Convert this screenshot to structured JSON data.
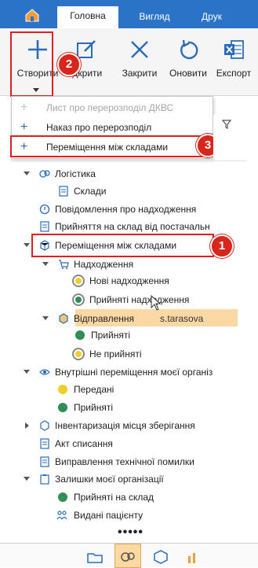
{
  "ribbon": {
    "tabs": [
      {
        "label": "Головна"
      },
      {
        "label": "Вигляд"
      },
      {
        "label": "Друк"
      }
    ],
    "toolbar": [
      {
        "label": "Створити",
        "icon": "plus-icon"
      },
      {
        "label": "Відкрити",
        "icon": "edit-icon"
      },
      {
        "label": "Закрити",
        "icon": "close-icon"
      },
      {
        "label": "Оновити",
        "icon": "refresh-icon"
      },
      {
        "label": "Експорт",
        "icon": "excel-icon"
      }
    ],
    "open_label_visible": "ідкрити"
  },
  "create_menu": {
    "items": [
      {
        "label": "Лист про перерозподіл ДКВС",
        "enabled": false
      },
      {
        "label": "Наказ про перерозподіл",
        "enabled": true
      },
      {
        "label": "Переміщення між складами",
        "enabled": true
      }
    ]
  },
  "tree": {
    "logistics": "Логістика",
    "warehouses": "Склади",
    "arrival_notice": "Повідомлення про надходження",
    "accepted_to_stock": "Прийняття на склад від постачальн",
    "transfers": "Переміщення між складами",
    "incoming": "Надходження",
    "new_incoming": "Нові надходження",
    "accepted_incoming": "Прийняті надходження",
    "outgoing": "Відправлення",
    "accepted": "Прийняті",
    "not_accepted": "Не прийняті",
    "internal_transfers": "Внутрішні переміщення моєї організ",
    "transferred": "Передані",
    "accepted2": "Прийняті",
    "inventory": "Інвентаризація місця зберігання",
    "writeoff": "Акт списання",
    "tech_fix": "Виправлення технічної помилки",
    "my_balances": "Залишки моєї організації",
    "accepted_to_stock2": "Прийняті на склад",
    "issued_to_patient": "Видані пацієнту"
  },
  "user_tooltip": "s.tarasova",
  "callouts": [
    "1",
    "2",
    "3"
  ],
  "more_indicator": "•••••",
  "colors": {
    "ribbon_blue": "#2b73c6",
    "callout_red": "#d9261c",
    "highlight": "#fcd9a4",
    "status_green": "#2f8f55",
    "status_yellow": "#f0cf2a"
  }
}
